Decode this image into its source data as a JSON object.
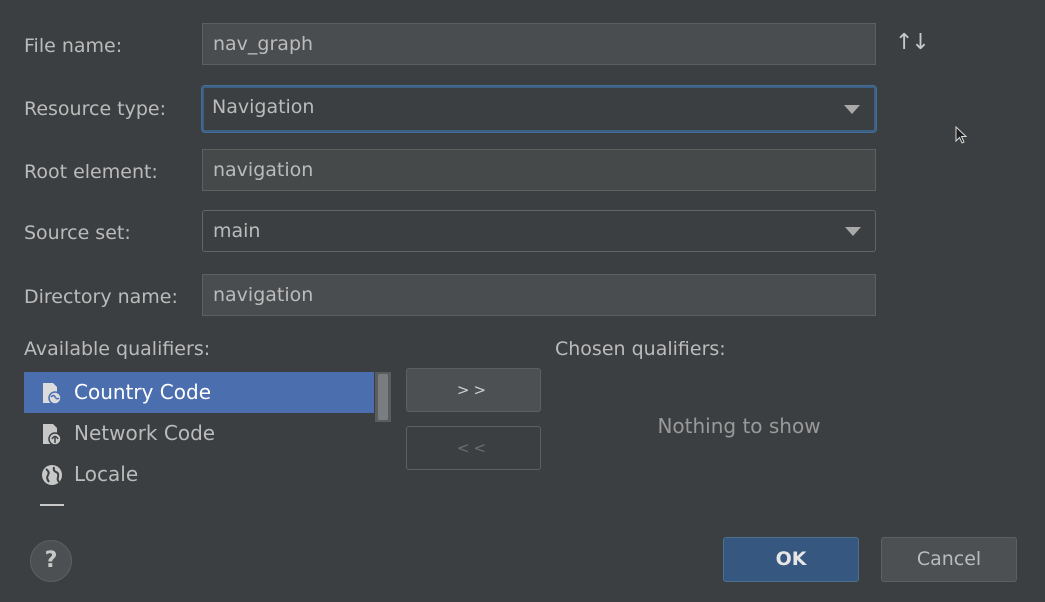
{
  "form": {
    "file_name": {
      "label": "File name:",
      "value": "nav_graph"
    },
    "resource_type": {
      "label": "Resource type:",
      "value": "Navigation"
    },
    "root_element": {
      "label": "Root element:",
      "value": "navigation"
    },
    "source_set": {
      "label": "Source set:",
      "value": "main"
    },
    "directory_name": {
      "label": "Directory name:",
      "value": "navigation"
    }
  },
  "icons": {
    "sort": "sort-arrows-icon",
    "dropdown": "chevron-down-icon",
    "help": "help-icon"
  },
  "qualifiers": {
    "available_label": "Available qualifiers:",
    "chosen_label": "Chosen qualifiers:",
    "items": [
      {
        "label": "Country Code",
        "icon": "country-code-icon",
        "selected": true
      },
      {
        "label": "Network Code",
        "icon": "network-code-icon",
        "selected": false
      },
      {
        "label": "Locale",
        "icon": "globe-icon",
        "selected": false
      }
    ],
    "add_label": ">>",
    "remove_label": "<<",
    "empty_text": "Nothing to show"
  },
  "buttons": {
    "help_label": "?",
    "ok_label": "OK",
    "cancel_label": "Cancel"
  },
  "colors": {
    "background": "#3c3f41",
    "selection": "#4b6eaf",
    "focus_border": "#3d6185",
    "ok_button": "#365880"
  }
}
